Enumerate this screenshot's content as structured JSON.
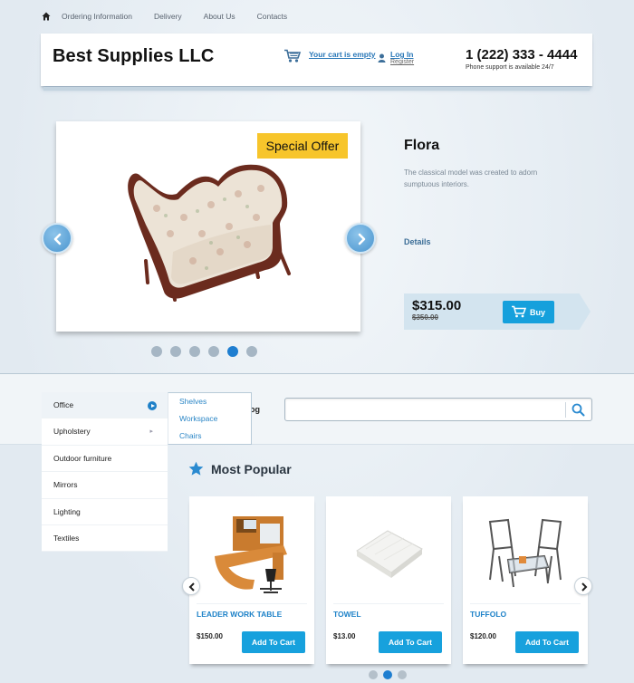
{
  "topnav": {
    "home_icon": "home-icon",
    "links": [
      "Ordering Information",
      "Delivery",
      "About Us",
      "Contacts"
    ]
  },
  "header": {
    "brand": "Best Supplies LLC",
    "cart_icon": "cart-icon",
    "cart_text": "Your cart is empty",
    "user_icon": "user-icon",
    "login": "Log In",
    "register": "Register",
    "phone": "1 (222) 333 - 4444",
    "phone_sub": "Phone support is available 24/7"
  },
  "slider": {
    "badge": "Special Offer",
    "title": "Flora",
    "description": "The classical model was created to adorn sumptuous interiors.",
    "details": "Details",
    "price": "$315.00",
    "old_price": "$350.00",
    "buy": "Buy",
    "dots": 6,
    "active_dot": 4
  },
  "catalog": {
    "label": "og",
    "search_placeholder": "",
    "categories": [
      "Office",
      "Upholstery",
      "Outdoor furniture",
      "Mirrors",
      "Lighting",
      "Textiles"
    ],
    "active_category": 0,
    "submenu": [
      "Shelves",
      "Workspace",
      "Chairs"
    ]
  },
  "popular": {
    "title": "Most Popular",
    "products": [
      {
        "name": "LEADER WORK TABLE",
        "price": "$150.00",
        "button": "Add To Cart"
      },
      {
        "name": "TOWEL",
        "price": "$13.00",
        "button": "Add To Cart"
      },
      {
        "name": "TUFFOLO",
        "price": "$120.00",
        "button": "Add To Cart"
      }
    ],
    "dots": 3,
    "active_dot": 1
  },
  "colors": {
    "accent": "#17a1dd",
    "badge": "#f7c52b",
    "link": "#2a78b8"
  }
}
